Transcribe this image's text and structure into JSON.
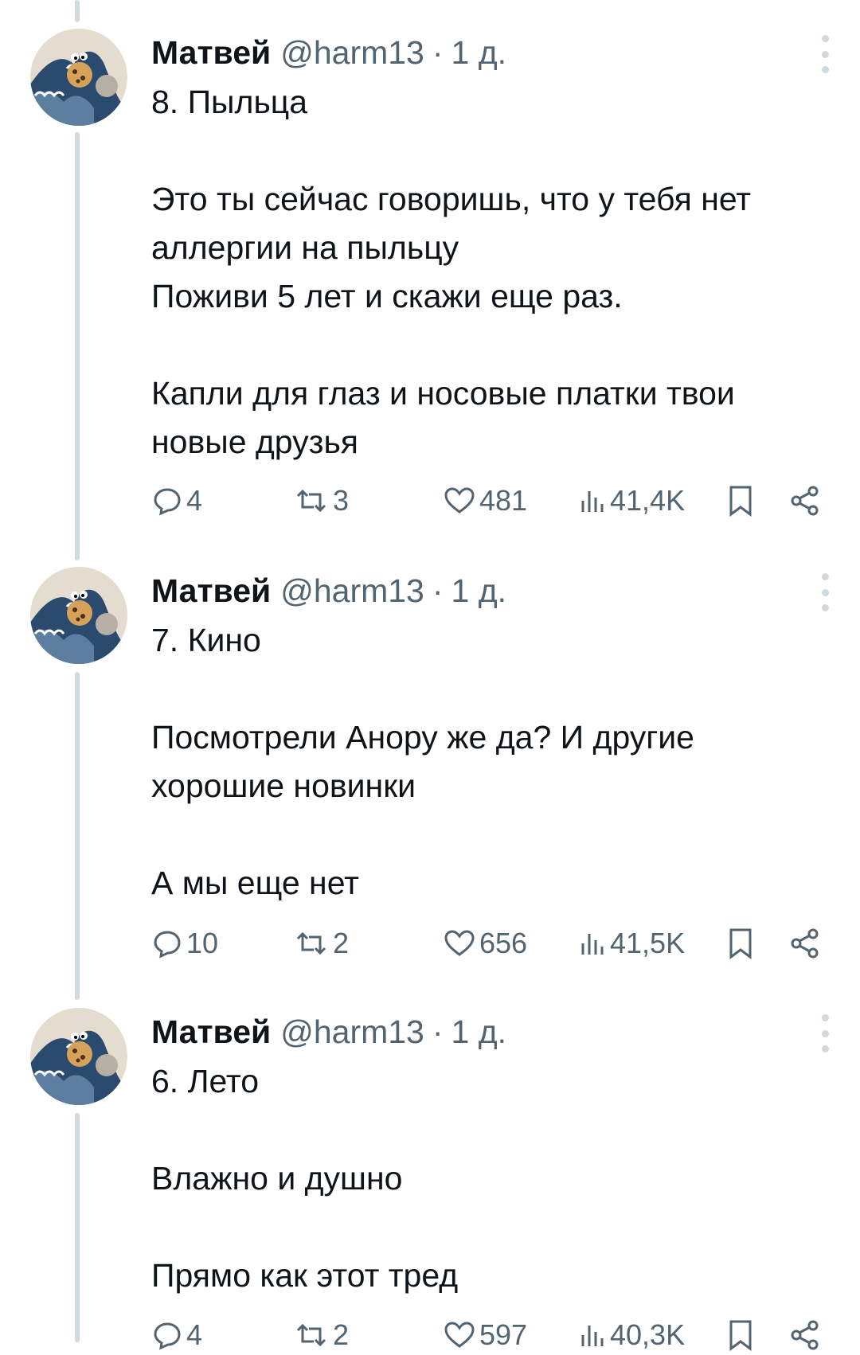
{
  "tweets": [
    {
      "author": "Матвей",
      "handle": "@harm13",
      "separator": "·",
      "time": "1 д.",
      "lines": [
        "8. Пыльца",
        "",
        "Это ты сейчас говоришь, что у тебя нет",
        "аллергии на пыльцу",
        "Поживи 5 лет и скажи еще раз.",
        "",
        "Капли для глаз и носовые платки твои",
        "новые друзья"
      ],
      "replies": "4",
      "retweets": "3",
      "likes": "481",
      "views": "41,4K"
    },
    {
      "author": "Матвей",
      "handle": "@harm13",
      "separator": "·",
      "time": "1 д.",
      "lines": [
        "7. Кино",
        "",
        "Посмотрели Анору же да? И другие",
        "хорошие новинки",
        "",
        "А мы еще нет"
      ],
      "replies": "10",
      "retweets": "2",
      "likes": "656",
      "views": "41,5K"
    },
    {
      "author": "Матвей",
      "handle": "@harm13",
      "separator": "·",
      "time": "1 д.",
      "lines": [
        "6. Лето",
        "",
        "Влажно и душно",
        "",
        "Прямо как этот тред"
      ],
      "replies": "4",
      "retweets": "2",
      "likes": "597",
      "views": "40,3K"
    }
  ],
  "icons": {
    "reply": "reply-icon",
    "retweet": "retweet-icon",
    "like": "heart-icon",
    "views": "views-chart-icon",
    "bookmark": "bookmark-icon",
    "share": "share-icon",
    "more": "more-vertical-icon"
  },
  "colors": {
    "text": "#0f1419",
    "muted": "#536471",
    "thread_line": "#cfd9de"
  }
}
